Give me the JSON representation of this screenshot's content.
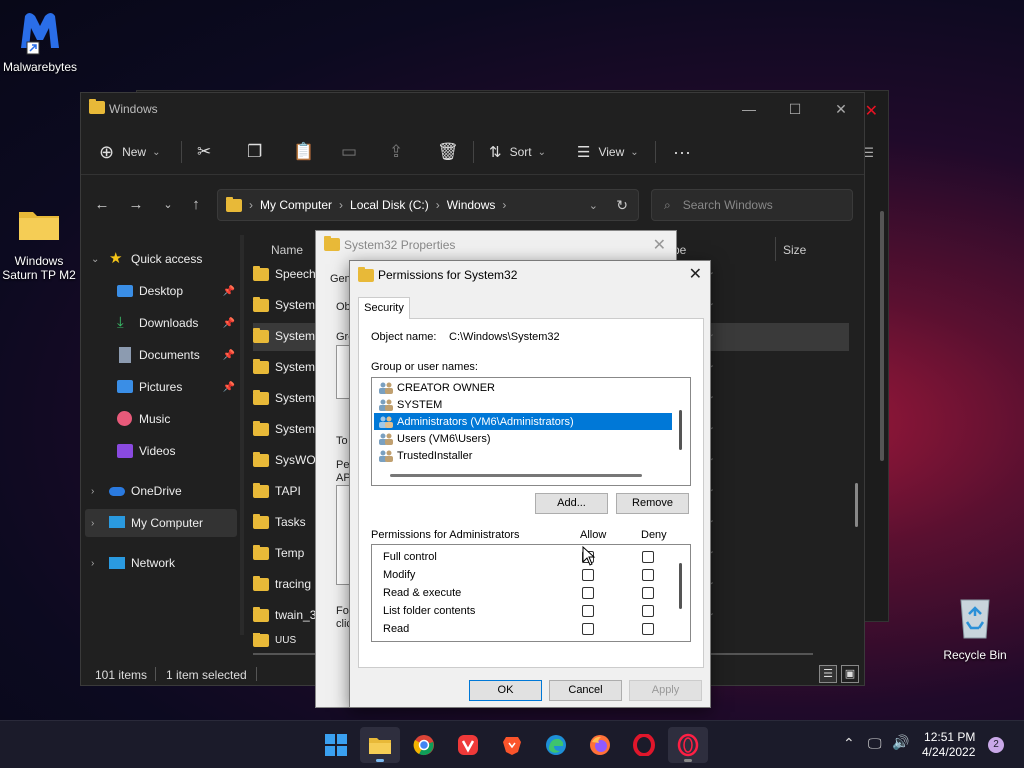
{
  "desktop": {
    "icons": [
      {
        "label": "Malwarebytes"
      },
      {
        "label": "Windows Saturn TP M2"
      },
      {
        "label": "Recycle Bin"
      }
    ]
  },
  "explorer": {
    "title": "Windows",
    "toolbar": {
      "new_label": "New",
      "sort_label": "Sort",
      "view_label": "View"
    },
    "address": {
      "crumbs": [
        "My Computer",
        "Local Disk (C:)",
        "Windows"
      ]
    },
    "search": {
      "placeholder": "Search Windows"
    },
    "nav": {
      "quick_access": "Quick access",
      "items": [
        {
          "label": "Desktop"
        },
        {
          "label": "Downloads"
        },
        {
          "label": "Documents"
        },
        {
          "label": "Pictures"
        },
        {
          "label": "Music"
        },
        {
          "label": "Videos"
        }
      ],
      "onedrive": "OneDrive",
      "my_computer": "My Computer",
      "network": "Network"
    },
    "columns": {
      "name": "Name",
      "type": "pe",
      "size": "Size"
    },
    "files": [
      {
        "name": "Speech"
      },
      {
        "name": "System"
      },
      {
        "name": "System"
      },
      {
        "name": "System"
      },
      {
        "name": "System"
      },
      {
        "name": "System"
      },
      {
        "name": "SysWO"
      },
      {
        "name": "TAPI"
      },
      {
        "name": "Tasks"
      },
      {
        "name": "Temp"
      },
      {
        "name": "tracing"
      },
      {
        "name": "twain_3"
      },
      {
        "name": "UUS"
      }
    ],
    "type_col": "r",
    "status": {
      "items": "101 items",
      "selected": "1 item selected"
    }
  },
  "props_dialog": {
    "title": "System32 Properties",
    "gen": "Gen",
    "obj": "Ob",
    "gro": "Gro",
    "to": "To",
    "pe": "Pe",
    "ap": "AP",
    "for": "For",
    "clic": "clic"
  },
  "perm_dialog": {
    "title": "Permissions for System32",
    "tab": "Security",
    "object_label": "Object name:",
    "object_value": "C:\\Windows\\System32",
    "group_label": "Group or user names:",
    "users": [
      {
        "name": "CREATOR OWNER"
      },
      {
        "name": "SYSTEM"
      },
      {
        "name": "Administrators (VM6\\Administrators)"
      },
      {
        "name": "Users (VM6\\Users)"
      },
      {
        "name": "TrustedInstaller"
      }
    ],
    "add_label": "Add...",
    "remove_label": "Remove",
    "perms_label": "Permissions for Administrators",
    "allow_label": "Allow",
    "deny_label": "Deny",
    "perms": [
      {
        "name": "Full control"
      },
      {
        "name": "Modify"
      },
      {
        "name": "Read & execute"
      },
      {
        "name": "List folder contents"
      },
      {
        "name": "Read"
      }
    ],
    "ok_label": "OK",
    "cancel_label": "Cancel",
    "apply_label": "Apply"
  },
  "taskbar": {
    "time": "12:51 PM",
    "date": "4/24/2022",
    "notifications": "2"
  }
}
